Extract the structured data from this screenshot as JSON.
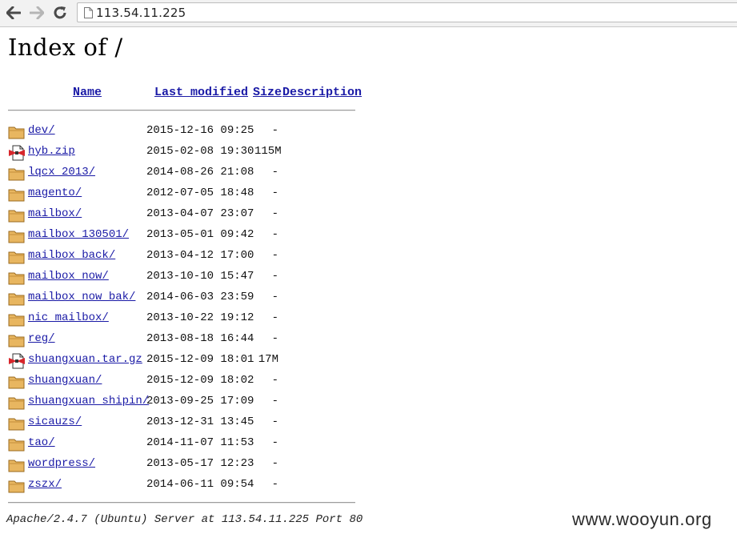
{
  "browser": {
    "url": "113.54.11.225"
  },
  "page": {
    "title": "Index of /",
    "columns": {
      "name": "Name",
      "last_modified": "Last modified",
      "size": "Size",
      "description": "Description"
    },
    "entries": [
      {
        "name": "dev/",
        "modified": "2015-12-16 09:25",
        "size": "-",
        "type": "folder"
      },
      {
        "name": "hyb.zip",
        "modified": "2015-02-08 19:30",
        "size": "115M",
        "type": "archive"
      },
      {
        "name": "lqcx 2013/",
        "modified": "2014-08-26 21:08",
        "size": "-",
        "type": "folder"
      },
      {
        "name": "magento/",
        "modified": "2012-07-05 18:48",
        "size": "-",
        "type": "folder"
      },
      {
        "name": "mailbox/",
        "modified": "2013-04-07 23:07",
        "size": "-",
        "type": "folder"
      },
      {
        "name": "mailbox 130501/",
        "modified": "2013-05-01 09:42",
        "size": "-",
        "type": "folder"
      },
      {
        "name": "mailbox back/",
        "modified": "2013-04-12 17:00",
        "size": "-",
        "type": "folder"
      },
      {
        "name": "mailbox now/",
        "modified": "2013-10-10 15:47",
        "size": "-",
        "type": "folder"
      },
      {
        "name": "mailbox now bak/",
        "modified": "2014-06-03 23:59",
        "size": "-",
        "type": "folder"
      },
      {
        "name": "nic mailbox/",
        "modified": "2013-10-22 19:12",
        "size": "-",
        "type": "folder"
      },
      {
        "name": "reg/",
        "modified": "2013-08-18 16:44",
        "size": "-",
        "type": "folder"
      },
      {
        "name": "shuangxuan.tar.gz",
        "modified": "2015-12-09 18:01",
        "size": "17M",
        "type": "archive"
      },
      {
        "name": "shuangxuan/",
        "modified": "2015-12-09 18:02",
        "size": "-",
        "type": "folder"
      },
      {
        "name": "shuangxuan shipin/",
        "modified": "2013-09-25 17:09",
        "size": "-",
        "type": "folder"
      },
      {
        "name": "sicauzs/",
        "modified": "2013-12-31 13:45",
        "size": "-",
        "type": "folder"
      },
      {
        "name": "tao/",
        "modified": "2014-11-07 11:53",
        "size": "-",
        "type": "folder"
      },
      {
        "name": "wordpress/",
        "modified": "2013-05-17 12:23",
        "size": "-",
        "type": "folder"
      },
      {
        "name": "zszx/",
        "modified": "2014-06-11 09:54",
        "size": "-",
        "type": "folder"
      }
    ],
    "address": "Apache/2.4.7 (Ubuntu) Server at 113.54.11.225 Port 80"
  },
  "watermark": "www.wooyun.org",
  "colors": {
    "link": "#1a1aa6",
    "folder": "#e8b660"
  }
}
